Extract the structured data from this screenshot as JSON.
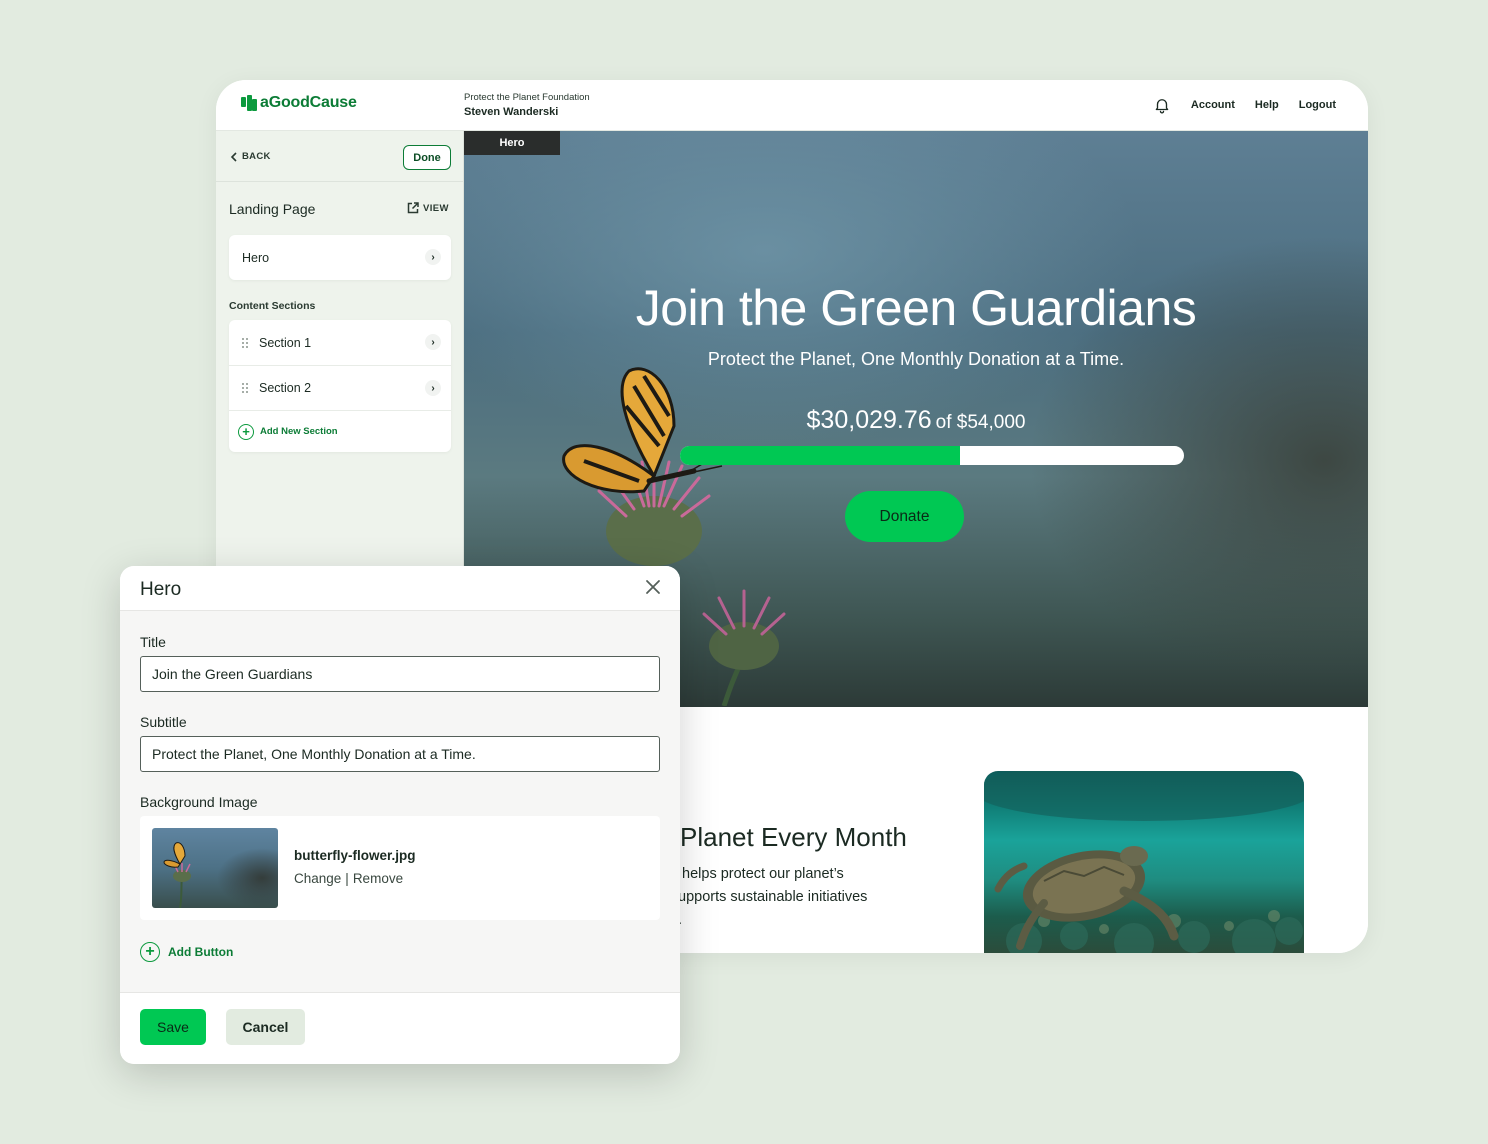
{
  "app": {
    "logo_text": "aGoodCause",
    "org_name": "Protect the Planet Foundation",
    "user_name": "Steven Wanderski",
    "nav": {
      "account": "Account",
      "help": "Help",
      "logout": "Logout"
    }
  },
  "sidebar": {
    "back_label": "BACK",
    "done_label": "Done",
    "page_title": "Landing Page",
    "view_label": "VIEW",
    "hero_item": "Hero",
    "content_sections_label": "Content Sections",
    "sections": [
      {
        "label": "Section 1"
      },
      {
        "label": "Section 2"
      }
    ],
    "add_section_label": "Add New Section"
  },
  "hero": {
    "tag": "Hero",
    "title": "Join the Green Guardians",
    "subtitle": "Protect the Planet, One Monthly Donation at a Time.",
    "raised": "$30,029.76",
    "goal": "of $54,000",
    "progress_fraction": 0.556,
    "donate_label": "Donate"
  },
  "section": {
    "heading": "Planet Every Month",
    "line1": " helps protect our planet’s",
    "line2": "upports sustainable initiatives",
    "line3": "."
  },
  "modal": {
    "title": "Hero",
    "title_label": "Title",
    "title_value": "Join the Green Guardians",
    "subtitle_label": "Subtitle",
    "subtitle_value": "Protect the Planet, One Monthly Donation at a Time.",
    "bg_label": "Background Image",
    "file_name": "butterfly-flower.jpg",
    "change_label": "Change",
    "separator": "|",
    "remove_label": "Remove",
    "add_button_label": "Add Button",
    "save_label": "Save",
    "cancel_label": "Cancel"
  },
  "colors": {
    "accent": "#00c853",
    "brand": "#0c7c36",
    "page_bg": "#e2ebe0",
    "sidebar_bg": "#eef3ec"
  },
  "icons": [
    "logo-icon",
    "bell-icon",
    "chevron-left-icon",
    "external-link-icon",
    "chevron-right-icon",
    "drag-handle-icon",
    "plus-circle-icon",
    "close-icon"
  ]
}
